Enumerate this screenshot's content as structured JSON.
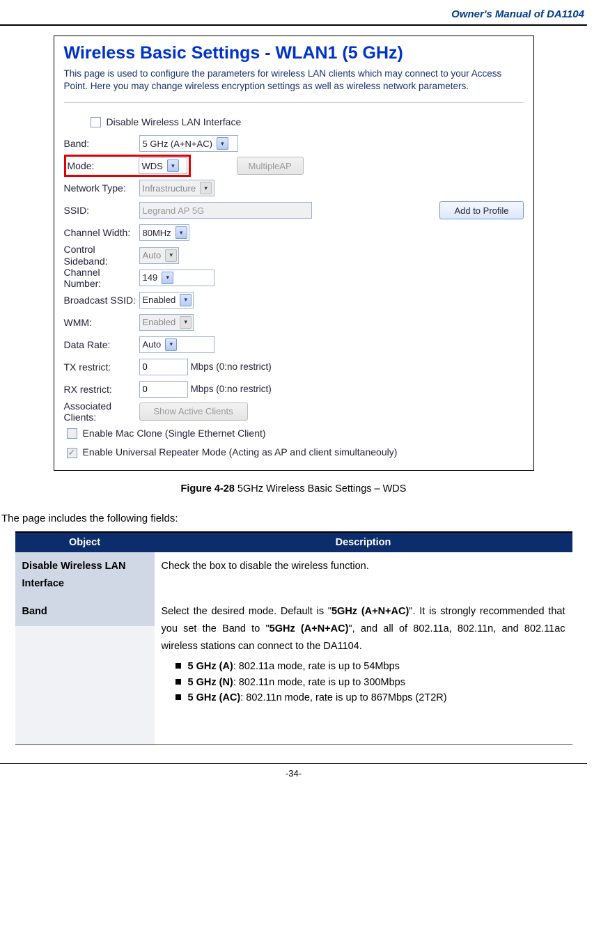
{
  "header": {
    "manual_title": "Owner's Manual of DA1104"
  },
  "screenshot": {
    "title": "Wireless Basic Settings - WLAN1 (5 GHz)",
    "intro": "This page is used to configure the parameters for wireless LAN clients which may connect to your Access Point. Here you may change wireless encryption settings as well as wireless network parameters.",
    "disable_cb_label": "Disable Wireless LAN Interface",
    "band_label": "Band:",
    "band_value": "5 GHz (A+N+AC)",
    "mode_label": "Mode:",
    "mode_value": "WDS",
    "multiple_ap_btn": "MultipleAP",
    "nettype_label": "Network Type:",
    "nettype_value": "Infrastructure",
    "ssid_label": "SSID:",
    "ssid_value": "Legrand AP 5G",
    "add_profile_btn": "Add to Profile",
    "chwidth_label": "Channel Width:",
    "chwidth_value": "80MHz",
    "ctrlsb_label": "Control Sideband:",
    "ctrlsb_value": "Auto",
    "chnum_label": "Channel Number:",
    "chnum_value": "149",
    "bssid_label": "Broadcast SSID:",
    "bssid_value": "Enabled",
    "wmm_label": "WMM:",
    "wmm_value": "Enabled",
    "datarate_label": "Data Rate:",
    "datarate_value": "Auto",
    "tx_label": "TX restrict:",
    "tx_value": "0",
    "tx_unit": "Mbps (0:no restrict)",
    "rx_label": "RX restrict:",
    "rx_value": "0",
    "rx_unit": "Mbps (0:no restrict)",
    "assoc_label": "Associated Clients:",
    "assoc_btn": "Show Active Clients",
    "macclone_label": "Enable Mac Clone (Single Ethernet Client)",
    "urepeater_label": "Enable Universal Repeater Mode (Acting as AP and client simultaneouly)"
  },
  "figure": {
    "num": "Figure 4-28",
    "caption": " 5GHz Wireless Basic Settings – WDS"
  },
  "lead": "The page includes the following fields:",
  "table": {
    "head_object": "Object",
    "head_desc": "Description",
    "row1_obj": "Disable Wireless LAN Interface",
    "row1_desc": "Check the box to disable the wireless function.",
    "row2_obj": "Band",
    "row2_desc_pre": "Select the desired mode. Default is \"",
    "row2_desc_b1": "5GHz (A+N+AC)",
    "row2_desc_mid": "\". It is strongly recommended that you set the Band to \"",
    "row2_desc_b2": "5GHz (A+N+AC)",
    "row2_desc_post": "\", and all of 802.11a, 802.11n, and 802.11ac wireless stations can connect to the DA1104.",
    "bul1_b": "5 GHz (A)",
    "bul1_t": ": 802.11a mode, rate is up to 54Mbps",
    "bul2_b": "5 GHz (N)",
    "bul2_t": ": 802.11n mode, rate is up to 300Mbps",
    "bul3_b": "5 GHz (AC)",
    "bul3_t": ": 802.11n mode, rate is up to 867Mbps (2T2R)"
  },
  "footer": {
    "page_num": "-34-"
  }
}
